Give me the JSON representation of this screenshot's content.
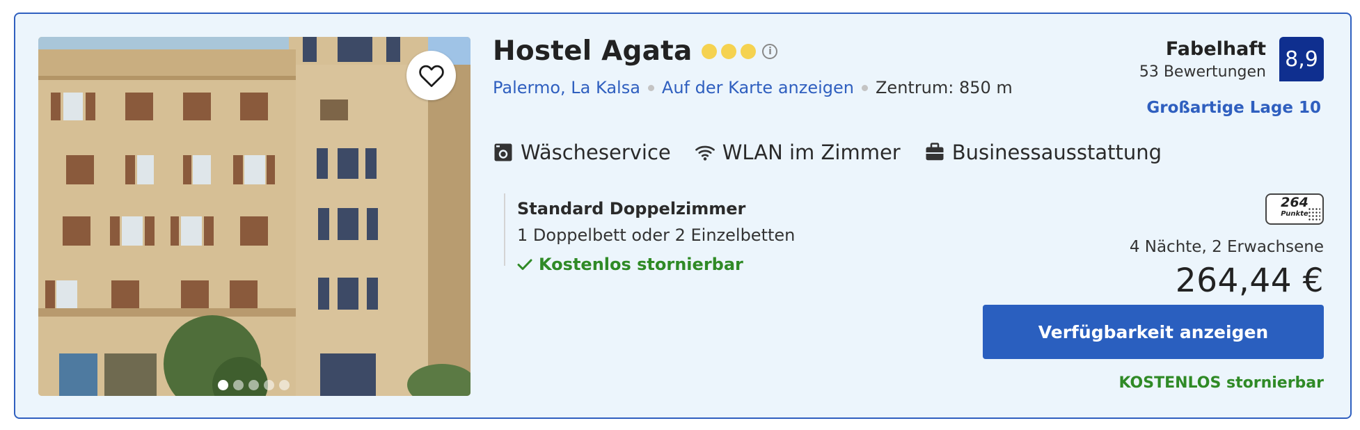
{
  "hotel": {
    "name": "Hostel Agata",
    "star_count": 3,
    "star_color": "#f5d250",
    "info_icon": "info-icon",
    "favorite_icon": "heart-outline-icon",
    "photo_dots": 5,
    "photo_active_index": 0
  },
  "location": {
    "area_link": "Palermo, La Kalsa",
    "map_link": "Auf der Karte anzeigen",
    "distance": "Zentrum: 850 m"
  },
  "facilities": [
    {
      "icon": "laundry-icon",
      "label": "Wäscheservice"
    },
    {
      "icon": "wifi-icon",
      "label": "WLAN im Zimmer"
    },
    {
      "icon": "briefcase-icon",
      "label": "Businessausstattung"
    }
  ],
  "room": {
    "type": "Standard Doppelzimmer",
    "beds": "1 Doppelbett oder 2 Einzelbetten",
    "cancellation": "Kostenlos stornierbar"
  },
  "rating": {
    "word": "Fabelhaft",
    "reviews": "53 Bewertungen",
    "score": "8,9",
    "location_score": "Großartige Lage 10",
    "badge_color": "#0f2f8f"
  },
  "points": {
    "value": "264",
    "label": "Punkte"
  },
  "pricing": {
    "stay": "4 Nächte, 2 Erwachsene",
    "price": "264,44 €",
    "cta": "Verfügbarkeit anzeigen",
    "free_cancel": "KOSTENLOS stornierbar"
  },
  "colors": {
    "link_blue": "#2f5fbf",
    "green": "#2f8a26",
    "card_bg": "#ecf5fc",
    "cta_bg": "#2a5fbf"
  }
}
